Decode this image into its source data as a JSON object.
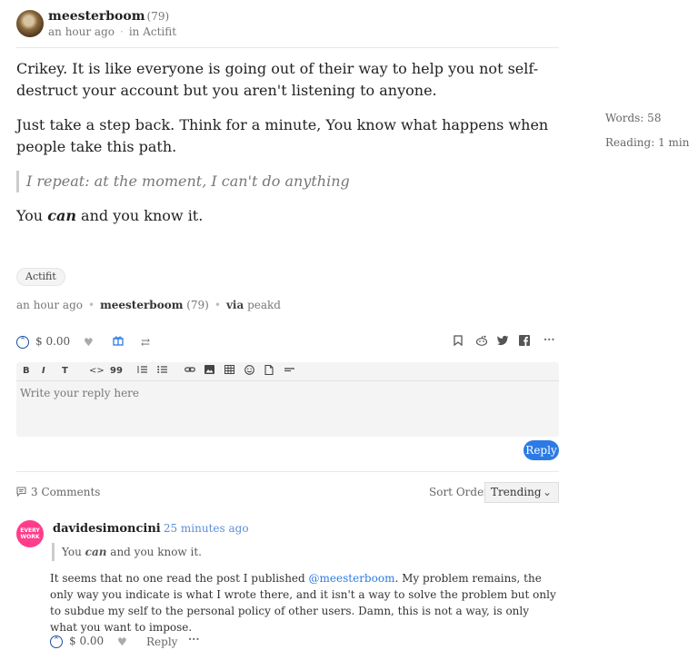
{
  "post": {
    "author": "meesterboom",
    "reputation": "(79)",
    "time": "an hour ago",
    "community": "in Actifit",
    "paragraphs": [
      "Crikey. It is like everyone is going out of their way to help you not self-destruct your account but you aren't listening to anyone.",
      "Just take a step back. Think for a minute, You know what happens when people take this path."
    ],
    "quote": "I repeat: at the moment, I can't do anything",
    "last_prefix": "You ",
    "last_em": "can",
    "last_suffix": " and you know it.",
    "tag": "Actifit",
    "footer": {
      "time": "an hour ago",
      "author": "meesterboom",
      "reputation": "(79)",
      "via_label": "via",
      "via_app": "peakd"
    },
    "payout": "$ 0.00"
  },
  "stats": {
    "words": "Words: 58",
    "reading": "Reading: 1 min"
  },
  "editor": {
    "toolbar": [
      "B",
      "I",
      "T",
      "<>",
      "99"
    ],
    "placeholder": "Write your reply here",
    "reply_label": "Reply"
  },
  "comments": {
    "count_label": "3 Comments",
    "sort_label": "Sort Order",
    "sort_value": "Trending",
    "items": [
      {
        "author": "davidesimoncini",
        "time": "25 minutes ago",
        "avatar_text_1": "EVERY",
        "avatar_text_2": "WORK",
        "quote_prefix": "You ",
        "quote_em": "can",
        "quote_suffix": " and you know it.",
        "body_1": "It seems that no one read the post I published ",
        "mention": "@meesterboom",
        "body_2": ". My problem remains, the only way you indicate is what I wrote there, and it isn't a way to solve the problem but only to subdue my self to the personal policy of other users. Damn, this is not a way, is only what you want to impose.",
        "payout": "$ 0.00",
        "reply_label": "Reply"
      }
    ]
  },
  "colors": {
    "accent": "#2c7be5",
    "link": "#5b8fd6",
    "upvote": "#1a5099",
    "comment_avatar": "#ff3d8b"
  }
}
